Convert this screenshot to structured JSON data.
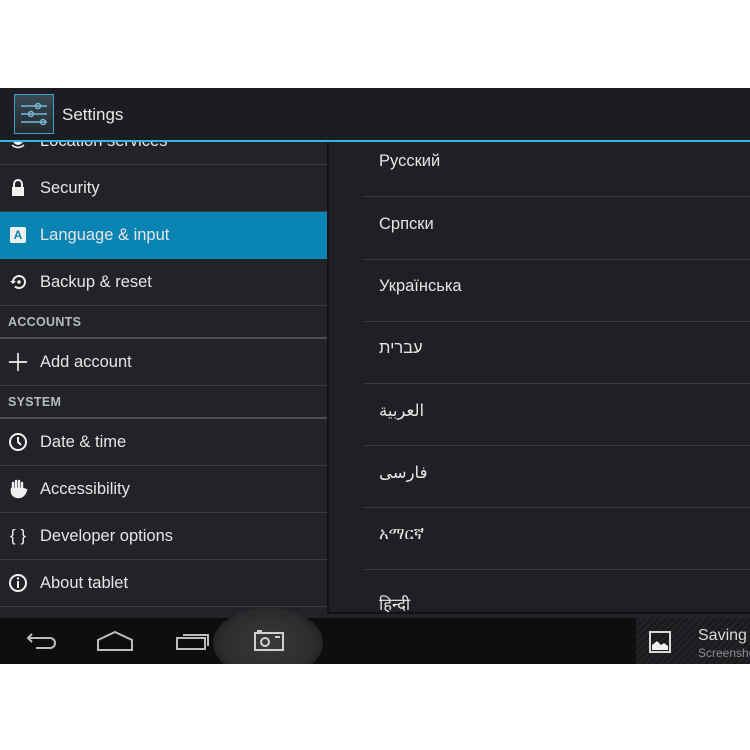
{
  "app": {
    "title": "Settings",
    "icon": "settings-sliders-icon"
  },
  "sidebar": {
    "items": [
      {
        "type": "item",
        "label": "Location services",
        "icon": "location-icon"
      },
      {
        "type": "item",
        "label": "Security",
        "icon": "lock-icon"
      },
      {
        "type": "item",
        "label": "Language & input",
        "icon": "language-icon",
        "active": true
      },
      {
        "type": "item",
        "label": "Backup & reset",
        "icon": "backup-icon"
      },
      {
        "type": "header",
        "label": "ACCOUNTS"
      },
      {
        "type": "item",
        "label": "Add account",
        "icon": "plus-icon"
      },
      {
        "type": "header",
        "label": "SYSTEM"
      },
      {
        "type": "item",
        "label": "Date & time",
        "icon": "clock-icon"
      },
      {
        "type": "item",
        "label": "Accessibility",
        "icon": "hand-icon"
      },
      {
        "type": "item",
        "label": "Developer options",
        "icon": "braces-icon"
      },
      {
        "type": "item",
        "label": "About tablet",
        "icon": "info-icon"
      }
    ]
  },
  "language_list": {
    "items": [
      "Русский",
      "Српски",
      "Українська",
      "עברית",
      "العربية",
      "فارسی",
      "አማርኛ",
      "हिन्दी"
    ]
  },
  "navbar": {
    "back": "back-icon",
    "home": "home-icon",
    "recents": "recents-icon",
    "screenshot": "camera-icon"
  },
  "notification": {
    "title": "Saving screenshot...",
    "subtitle": "Screenshot is being saved.",
    "icon": "image-icon"
  },
  "colors": {
    "accent": "#33b5e5",
    "active_item": "#0a84b3",
    "background": "#212327"
  }
}
